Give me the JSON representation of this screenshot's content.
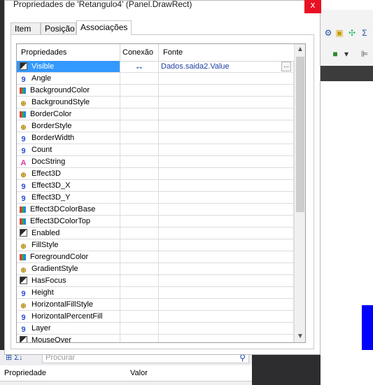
{
  "dialog": {
    "title": "Propriedades de 'Retangulo4' (Panel.DrawRect)",
    "close_glyph": "x"
  },
  "tabs": [
    {
      "label": "Item"
    },
    {
      "label": "Posição"
    },
    {
      "label": "Associações"
    }
  ],
  "grid": {
    "columns": [
      "Propriedades",
      "Conexão",
      "Fonte"
    ],
    "rows": [
      {
        "name": "Visible",
        "icon": "bool",
        "conn": "↔",
        "source": "Dados.saida2.Value"
      },
      {
        "name": "Angle",
        "icon": "num",
        "conn": "",
        "source": ""
      },
      {
        "name": "BackgroundColor",
        "icon": "color",
        "conn": "",
        "source": ""
      },
      {
        "name": "BackgroundStyle",
        "icon": "style",
        "conn": "",
        "source": ""
      },
      {
        "name": "BorderColor",
        "icon": "color",
        "conn": "",
        "source": ""
      },
      {
        "name": "BorderStyle",
        "icon": "style",
        "conn": "",
        "source": ""
      },
      {
        "name": "BorderWidth",
        "icon": "num",
        "conn": "",
        "source": ""
      },
      {
        "name": "Count",
        "icon": "num",
        "conn": "",
        "source": ""
      },
      {
        "name": "DocString",
        "icon": "text",
        "conn": "",
        "source": ""
      },
      {
        "name": "Effect3D",
        "icon": "style",
        "conn": "",
        "source": ""
      },
      {
        "name": "Effect3D_X",
        "icon": "num",
        "conn": "",
        "source": ""
      },
      {
        "name": "Effect3D_Y",
        "icon": "num",
        "conn": "",
        "source": ""
      },
      {
        "name": "Effect3DColorBase",
        "icon": "color",
        "conn": "",
        "source": ""
      },
      {
        "name": "Effect3DColorTop",
        "icon": "color",
        "conn": "",
        "source": ""
      },
      {
        "name": "Enabled",
        "icon": "bool",
        "conn": "",
        "source": ""
      },
      {
        "name": "FillStyle",
        "icon": "style",
        "conn": "",
        "source": ""
      },
      {
        "name": "ForegroundColor",
        "icon": "color",
        "conn": "",
        "source": ""
      },
      {
        "name": "GradientStyle",
        "icon": "style",
        "conn": "",
        "source": ""
      },
      {
        "name": "HasFocus",
        "icon": "bool",
        "conn": "",
        "source": ""
      },
      {
        "name": "Height",
        "icon": "num",
        "conn": "",
        "source": ""
      },
      {
        "name": "HorizontalFillStyle",
        "icon": "style",
        "conn": "",
        "source": ""
      },
      {
        "name": "HorizontalPercentFill",
        "icon": "num",
        "conn": "",
        "source": ""
      },
      {
        "name": "Layer",
        "icon": "num",
        "conn": "",
        "source": ""
      },
      {
        "name": "MouseOver",
        "icon": "bool",
        "conn": "",
        "source": ""
      }
    ],
    "ellipsis_label": "..."
  },
  "icon_glyphs": {
    "bool": "",
    "num": "9",
    "color": "",
    "style": "⊕",
    "text": "A"
  },
  "bottom_panel": {
    "search_placeholder": "Procurar",
    "col_property": "Propriedade",
    "col_value": "Valor"
  },
  "colors": {
    "selection": "#3399ff",
    "close": "#e81123",
    "link": "#1f3fa0"
  }
}
